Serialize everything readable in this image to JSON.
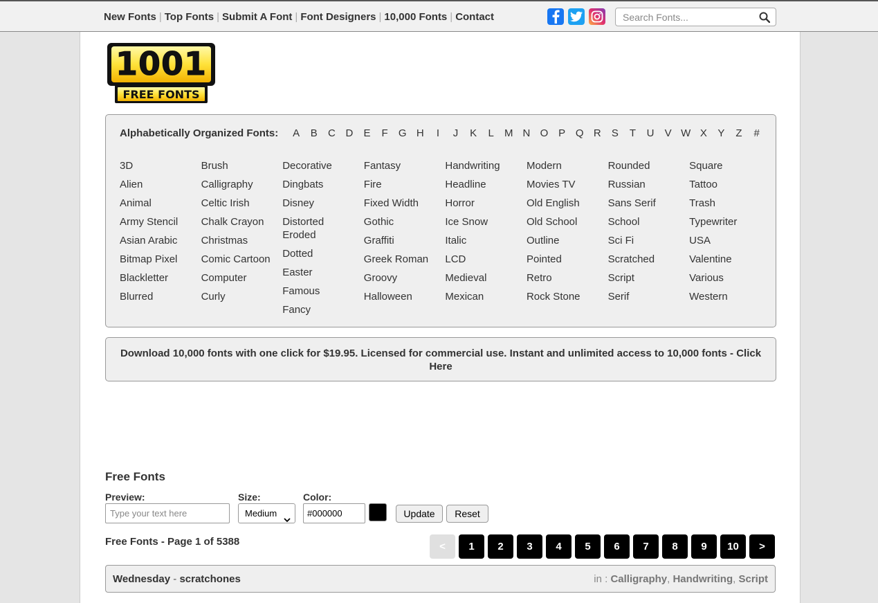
{
  "nav": {
    "items": [
      "New Fonts",
      "Top Fonts",
      "Submit A Font",
      "Font Designers",
      "10,000 Fonts",
      "Contact"
    ],
    "social": [
      "facebook-icon",
      "twitter-icon",
      "instagram-icon"
    ],
    "search_placeholder": "Search Fonts..."
  },
  "logo": {
    "top": "1001",
    "bottom": "FREE FONTS"
  },
  "categories": {
    "alpha_label": "Alphabetically Organized Fonts:",
    "letters": [
      "A",
      "B",
      "C",
      "D",
      "E",
      "F",
      "G",
      "H",
      "I",
      "J",
      "K",
      "L",
      "M",
      "N",
      "O",
      "P",
      "Q",
      "R",
      "S",
      "T",
      "U",
      "V",
      "W",
      "X",
      "Y",
      "Z",
      "#"
    ],
    "columns": [
      [
        "3D",
        "Alien",
        "Animal",
        "Army Stencil",
        "Asian Arabic",
        "Bitmap Pixel",
        "Blackletter",
        "Blurred"
      ],
      [
        "Brush",
        "Calligraphy",
        "Celtic Irish",
        "Chalk Crayon",
        "Christmas",
        "Comic Cartoon",
        "Computer",
        "Curly"
      ],
      [
        "Decorative",
        "Dingbats",
        "Disney",
        "Distorted Eroded",
        "Dotted",
        "Easter",
        "Famous",
        "Fancy"
      ],
      [
        "Fantasy",
        "Fire",
        "Fixed Width",
        "Gothic",
        "Graffiti",
        "Greek Roman",
        "Groovy",
        "Halloween"
      ],
      [
        "Handwriting",
        "Headline",
        "Horror",
        "Ice Snow",
        "Italic",
        "LCD",
        "Medieval",
        "Mexican"
      ],
      [
        "Modern",
        "Movies TV",
        "Old English",
        "Old School",
        "Outline",
        "Pointed",
        "Retro",
        "Rock Stone"
      ],
      [
        "Rounded",
        "Russian",
        "Sans Serif",
        "School",
        "Sci Fi",
        "Scratched",
        "Script",
        "Serif"
      ],
      [
        "Square",
        "Tattoo",
        "Trash",
        "Typewriter",
        "USA",
        "Valentine",
        "Various",
        "Western"
      ]
    ]
  },
  "promo": "Download 10,000 fonts with one click for $19.95. Licensed for commercial use. Instant and unlimited access to 10,000 fonts - Click Here",
  "free_fonts": {
    "title": "Free Fonts",
    "preview_label": "Preview:",
    "preview_placeholder": "Type your text here",
    "size_label": "Size:",
    "size_value": "Medium",
    "color_label": "Color:",
    "color_value": "#000000",
    "update_label": "Update",
    "reset_label": "Reset",
    "page_info": "Free Fonts - Page 1 of 5388",
    "pages": [
      "<",
      "1",
      "2",
      "3",
      "4",
      "5",
      "6",
      "7",
      "8",
      "9",
      "10",
      ">"
    ]
  },
  "font_row": {
    "font_name": "Wednesday",
    "separator": " - ",
    "designer": "scratchones",
    "in_label": "in : ",
    "categories": [
      "Calligraphy",
      "Handwriting",
      "Script"
    ]
  }
}
